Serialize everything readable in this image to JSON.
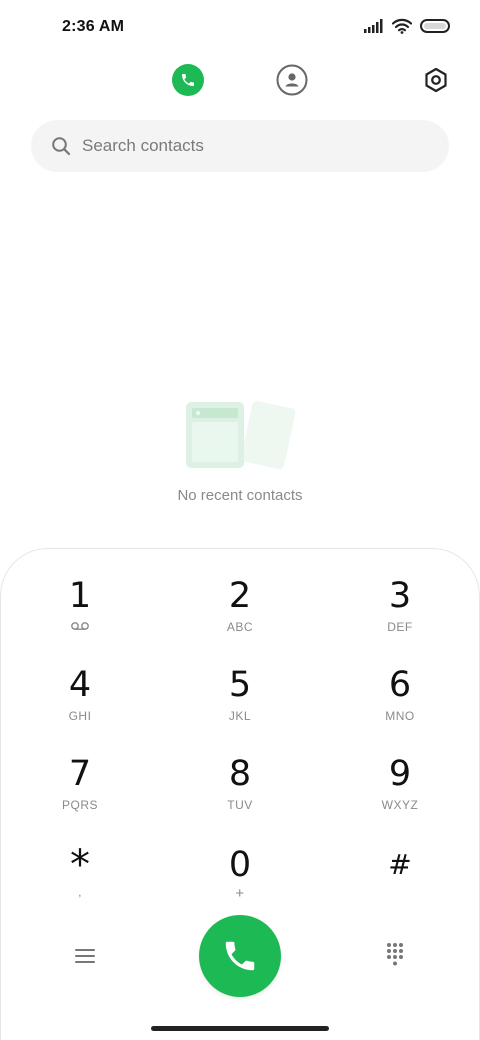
{
  "status_bar": {
    "time": "2:36 AM"
  },
  "tabs": [
    {
      "id": "recents",
      "icon": "phone-icon",
      "active": true
    },
    {
      "id": "contacts",
      "icon": "person-icon",
      "active": false
    }
  ],
  "settings": {
    "icon": "gear-icon"
  },
  "search": {
    "placeholder": "Search contacts",
    "value": ""
  },
  "empty_state": {
    "text": "No recent contacts"
  },
  "dialpad": {
    "keys": [
      {
        "digit": "1",
        "letters": ""
      },
      {
        "digit": "2",
        "letters": "ABC"
      },
      {
        "digit": "3",
        "letters": "DEF"
      },
      {
        "digit": "4",
        "letters": "GHI"
      },
      {
        "digit": "5",
        "letters": "JKL"
      },
      {
        "digit": "6",
        "letters": "MNO"
      },
      {
        "digit": "7",
        "letters": "PQRS"
      },
      {
        "digit": "8",
        "letters": "TUV"
      },
      {
        "digit": "9",
        "letters": "WXYZ"
      },
      {
        "digit": "*",
        "letters": ","
      },
      {
        "digit": "0",
        "letters": "+"
      },
      {
        "digit": "#",
        "letters": ""
      }
    ]
  },
  "colors": {
    "accent": "#1db954",
    "search_bg": "#f4f4f4",
    "muted_text": "#8a8a8a"
  }
}
